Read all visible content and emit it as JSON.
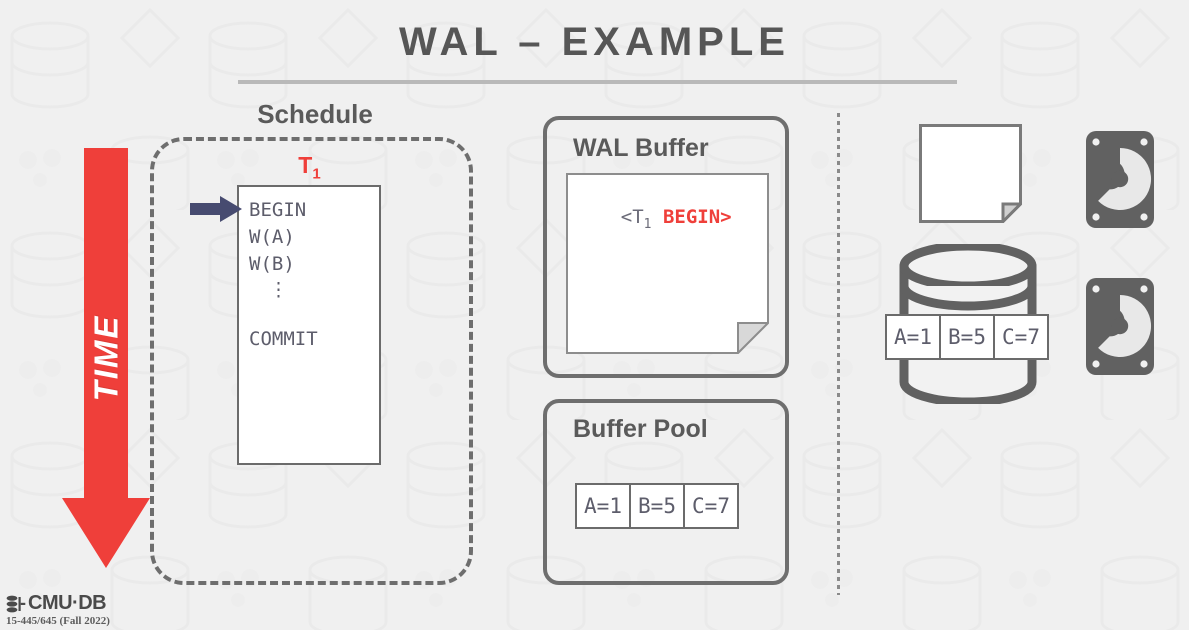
{
  "slide": {
    "title": "WAL – EXAMPLE"
  },
  "time_axis": {
    "label": "TIME",
    "color": "#ef3f3a"
  },
  "schedule": {
    "label": "Schedule",
    "transaction_label": "T",
    "transaction_subscript": "1",
    "transaction_color": "#ef3f3a",
    "operations": [
      "BEGIN",
      "W(A)",
      "W(B)",
      "⋮",
      "",
      "COMMIT"
    ],
    "cursor_operation": "BEGIN",
    "cursor_color": "#474b70"
  },
  "wal_buffer": {
    "title": "WAL Buffer",
    "records": [
      {
        "open": "<T",
        "subscript": "1",
        "body": "BEGIN>",
        "body_color": "#ef3f3a"
      }
    ]
  },
  "buffer_pool": {
    "title": "Buffer Pool",
    "slots": [
      "A=1",
      "B=5",
      "C=7"
    ]
  },
  "disk": {
    "log_page_empty": true,
    "database_slots": [
      "A=1",
      "B=5",
      "C=7"
    ],
    "drive_icons": [
      "hard-drive",
      "hard-drive"
    ]
  },
  "footer": {
    "brand": "CMU·DB",
    "course": "15-445/645 (Fall 2022)"
  },
  "icons": {
    "page": "document-page-icon",
    "cylinder": "database-cylinder-icon",
    "hdd": "hard-drive-icon",
    "arrow_right": "arrow-right-icon",
    "arrow_down": "arrow-down-icon"
  }
}
